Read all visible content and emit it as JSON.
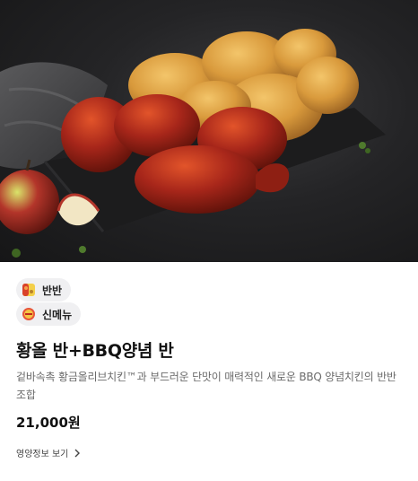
{
  "hero": {
    "image_icon": "fried-chicken-photo-icon"
  },
  "badges": [
    {
      "label": "반반",
      "icon": "half-half-icon"
    },
    {
      "label": "신메뉴",
      "icon": "new-menu-icon"
    }
  ],
  "product": {
    "title": "황올 반+BBQ양념 반",
    "description": "겉바속촉 황금올리브치킨™과 부드러운 단맛이 매력적인 새로운 BBQ 양념치킨의 반반 조합",
    "price": "21,000원"
  },
  "nutrition_link": {
    "label": "영양정보 보기",
    "icon": "chevron-right-icon"
  }
}
